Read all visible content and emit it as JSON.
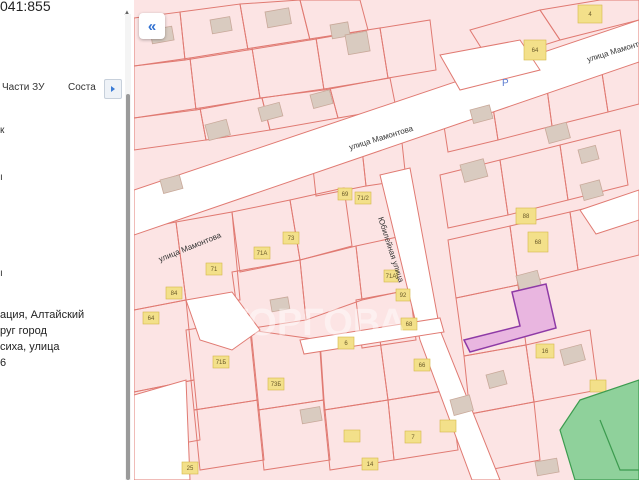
{
  "panel": {
    "cadastral_number": "041:855",
    "tabs": [
      {
        "label": "Части ЗУ"
      },
      {
        "label": "Соста"
      }
    ],
    "fragments": [
      "к",
      "ı",
      "ı"
    ],
    "address_lines": [
      "ация, Алтайский",
      "руг город",
      "сиха, улица",
      "6"
    ]
  },
  "map": {
    "street_labels": [
      "улица Мамонтова",
      "улица Мамонтова",
      "Юбилейная улица"
    ],
    "watermark": "ТОРГОВА",
    "house_numbers": [
      "71",
      "73",
      "71А",
      "71/2",
      "69",
      "71Б",
      "73Б",
      "84",
      "64",
      "71А",
      "92",
      "68",
      "66",
      "6",
      "7",
      "14",
      "25",
      "64",
      "4",
      "88",
      "68",
      "16"
    ],
    "parking_label": "P",
    "colors": {
      "parcel_fill": "#fce4e4",
      "parcel_line": "#e07a72",
      "road": "#ffffff",
      "building": "#d9cbc0",
      "selected_fill": "#e9b6e0",
      "selected_line": "#8e3aa6",
      "green": "#8fd19b",
      "house_tag": "#f3e08a"
    }
  },
  "controls": {
    "collapse_icon": "chevrons-left-icon",
    "collapse_glyph": "«",
    "tabs_next_icon": "triangle-right-icon",
    "scroll_up_glyph": "▲"
  }
}
